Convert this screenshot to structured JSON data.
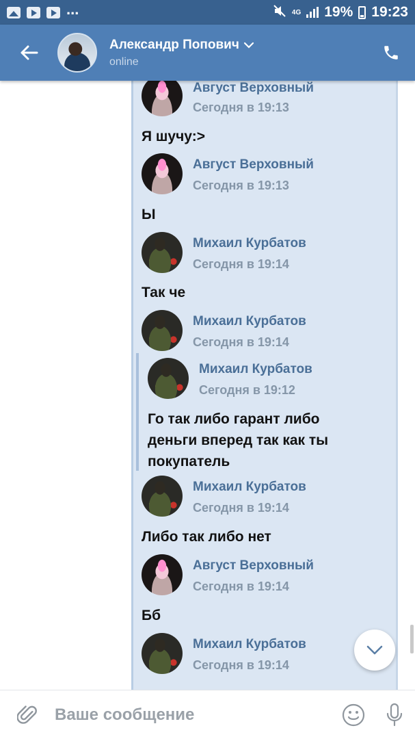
{
  "status_bar": {
    "battery": "19%",
    "time": "19:23",
    "network": "4G",
    "dots": "..."
  },
  "header": {
    "contact_name": "Александр Попович",
    "status": "online"
  },
  "messages": [
    {
      "sender": "Август Верховный",
      "time": "Сегодня в 19:13",
      "text": "Я шучу:>"
    },
    {
      "sender": "Август Верховный",
      "time": "Сегодня в 19:13",
      "text": "Ы"
    },
    {
      "sender": "Михаил Курбатов",
      "time": "Сегодня в 19:14",
      "text": "Так че"
    },
    {
      "sender": "Михаил Курбатов",
      "time": "Сегодня в 19:14",
      "text": ""
    },
    {
      "sender": "Михаил Курбатов",
      "time": "Сегодня в 19:12",
      "text_lines": [
        "Го так либо гарант либо",
        "деньги вперед так как ты",
        "покупатель"
      ]
    },
    {
      "sender": "Михаил Курбатов",
      "time": "Сегодня в 19:14",
      "text": "Либо так либо нет"
    },
    {
      "sender": "Август Верховный",
      "time": "Сегодня в 19:14",
      "text": "Бб"
    },
    {
      "sender": "Михаил Курбатов",
      "time": "Сегодня в 19:14",
      "text": ""
    }
  ],
  "input": {
    "placeholder": "Ваше сообщение"
  },
  "icons": {
    "back": "arrow-left-icon",
    "chevron": "chevron-down-icon",
    "call": "phone-icon",
    "scroll": "chevron-down-icon",
    "attach": "paperclip-icon",
    "emoji": "smiley-icon",
    "mic": "microphone-icon"
  },
  "colors": {
    "status_bar": "#38618f",
    "header": "#4f7fb6",
    "panel": "#dbe6f3",
    "sender": "#4a6f97",
    "time": "#8596a8"
  }
}
